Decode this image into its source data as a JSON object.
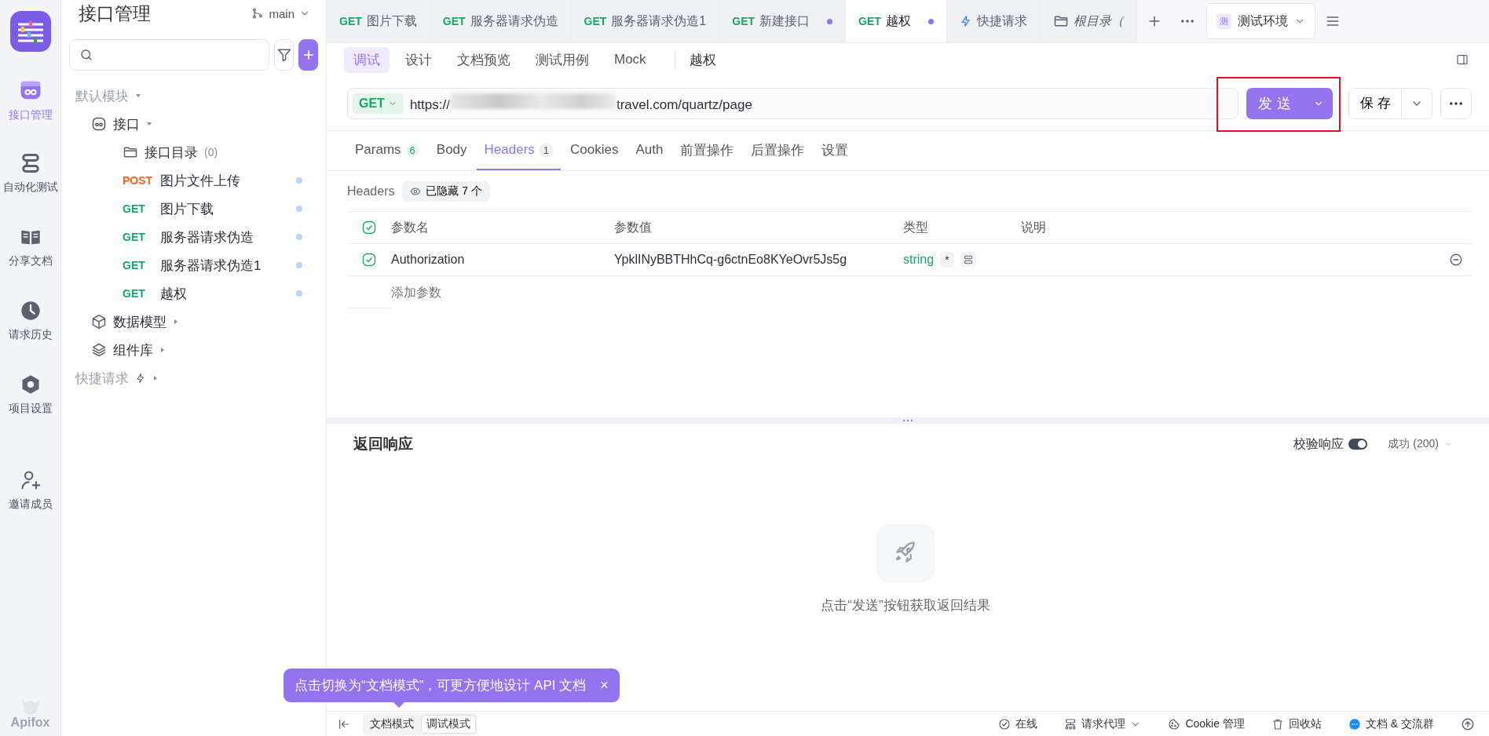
{
  "rail": {
    "items": [
      {
        "kind": "api",
        "label": "接口管理",
        "selected": true
      },
      {
        "kind": "automation",
        "label": "自动化测试",
        "selected": false
      },
      {
        "kind": "docs",
        "label": "分享文档",
        "selected": false
      },
      {
        "kind": "history",
        "label": "请求历史",
        "selected": false
      },
      {
        "kind": "settings",
        "label": "项目设置",
        "selected": false
      },
      {
        "kind": "invite",
        "label": "邀请成员",
        "selected": false
      }
    ],
    "brand": "Apifox"
  },
  "sidebar": {
    "title": "接口管理",
    "branch": "main",
    "tree": [
      {
        "kind": "module",
        "label": "默认模块",
        "expanded": true,
        "children": [
          {
            "kind": "api",
            "label": "接口",
            "expanded": true,
            "children": [
              {
                "kind": "folder",
                "label": "接口目录",
                "count": "(0)"
              },
              {
                "kind": "endpoint",
                "method": "POST",
                "color": "#f5661f",
                "label": "图片文件上传"
              },
              {
                "kind": "endpoint",
                "method": "GET",
                "color": "#17a862",
                "label": "图片下载"
              },
              {
                "kind": "endpoint",
                "method": "GET",
                "color": "#17a862",
                "label": "服务器请求伪造"
              },
              {
                "kind": "endpoint",
                "method": "GET",
                "color": "#17a862",
                "label": "服务器请求伪造1"
              },
              {
                "kind": "endpoint",
                "method": "GET",
                "color": "#17a862",
                "label": "越权"
              }
            ]
          },
          {
            "kind": "schema",
            "label": "数据模型",
            "expanded": false
          },
          {
            "kind": "components",
            "label": "组件库",
            "expanded": false
          }
        ]
      },
      {
        "kind": "quick",
        "label": "快捷请求",
        "expanded": false
      }
    ]
  },
  "tabs": [
    {
      "kind": "request",
      "method": "GET",
      "label": "图片下载",
      "modified": false,
      "selected": false
    },
    {
      "kind": "request",
      "method": "GET",
      "label": "服务器请求伪造",
      "modified": false,
      "selected": false
    },
    {
      "kind": "request",
      "method": "GET",
      "label": "服务器请求伪造1",
      "modified": false,
      "selected": false
    },
    {
      "kind": "request",
      "method": "GET",
      "label": "新建接口",
      "modified": true,
      "selected": false
    },
    {
      "kind": "request",
      "method": "GET",
      "label": "越权",
      "modified": true,
      "selected": true
    },
    {
      "kind": "quick",
      "label": "快捷请求",
      "selected": false
    },
    {
      "kind": "folder",
      "label": "根目录（",
      "selected": false
    }
  ],
  "environment": {
    "badge": "测",
    "label": "测试环境"
  },
  "subtabs": [
    {
      "label": "调试",
      "selected": true
    },
    {
      "label": "设计",
      "selected": false
    },
    {
      "label": "文档预览",
      "selected": false
    },
    {
      "label": "测试用例",
      "selected": false
    },
    {
      "label": "Mock",
      "selected": false
    }
  ],
  "request_title": "越权",
  "request": {
    "method": "GET",
    "url_start": "https://",
    "url_end": "travel.com/quartz/page",
    "send": "发送",
    "save": "保存"
  },
  "param_tabs": [
    {
      "label": "Params",
      "count": "6",
      "selected": false
    },
    {
      "label": "Body",
      "selected": false
    },
    {
      "label": "Headers",
      "count": "1",
      "selected": true
    },
    {
      "label": "Cookies",
      "selected": false
    },
    {
      "label": "Auth",
      "selected": false
    },
    {
      "label": "前置操作",
      "selected": false
    },
    {
      "label": "后置操作",
      "selected": false
    },
    {
      "label": "设置",
      "selected": false
    }
  ],
  "headers": {
    "label": "Headers",
    "hidden_badge": "已隐藏 7 个",
    "columns": [
      "参数名",
      "参数值",
      "类型",
      "说明"
    ],
    "all_checked": true,
    "rows": [
      {
        "checked": true,
        "name": "Authorization",
        "value": "YpklINyBBTHhCq-g6ctnEo8KYeOvr5Js5g",
        "type": "string",
        "required": "*"
      }
    ],
    "add_placeholder": "添加参数"
  },
  "response": {
    "title": "返回响应",
    "validate_label": "校验响应",
    "validate_on": true,
    "status": "成功 (200)",
    "empty_text": "点击“发送”按钮获取返回结果"
  },
  "toast": {
    "text": "点击切换为“文档模式”，可更方便地设计 API 文档",
    "close": "×"
  },
  "status_bar": {
    "modes": [
      {
        "label": "文档模式",
        "selected": false
      },
      {
        "label": "调试模式",
        "selected": true
      }
    ],
    "items": [
      {
        "kind": "online",
        "label": "在线"
      },
      {
        "kind": "proxy",
        "label": "请求代理"
      },
      {
        "kind": "cookie",
        "label": "Cookie 管理"
      },
      {
        "kind": "trash",
        "label": "回收站"
      },
      {
        "kind": "chat",
        "label": "文档 & 交流群"
      }
    ]
  }
}
